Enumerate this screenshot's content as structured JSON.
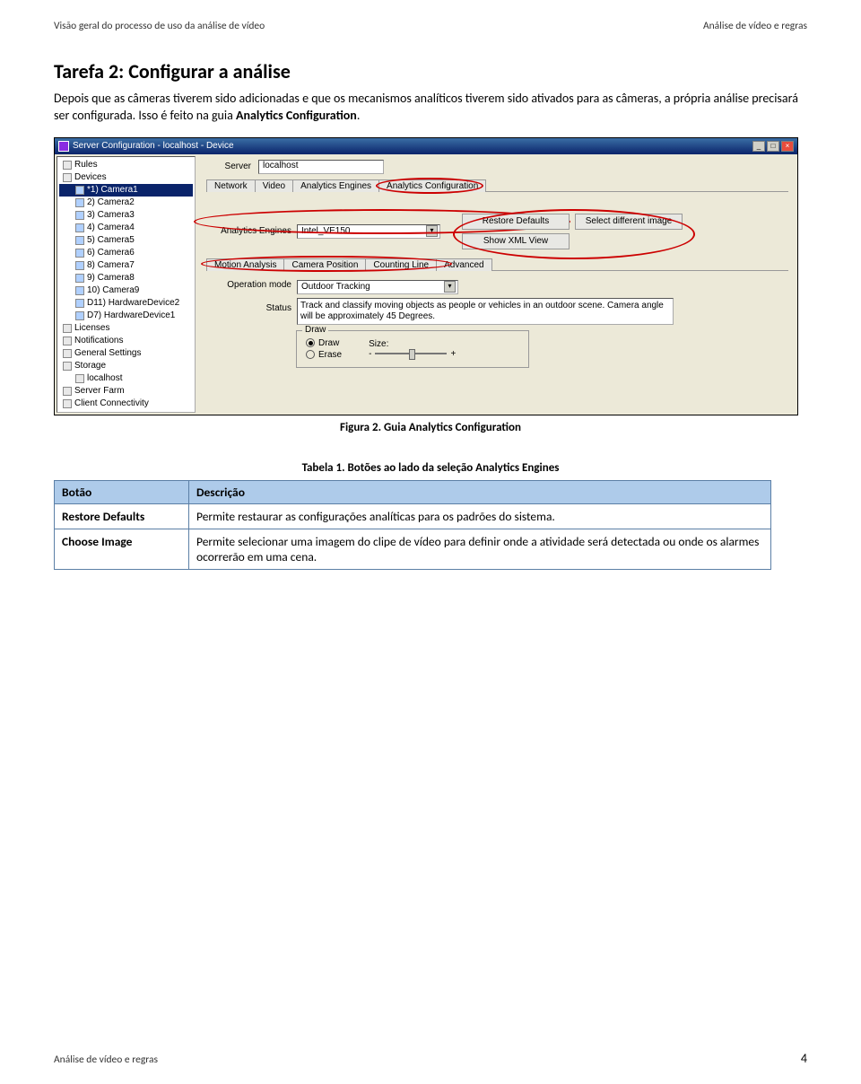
{
  "header": {
    "left": "Visão geral do processo de uso da análise de vídeo",
    "right": "Análise de vídeo e regras"
  },
  "task": {
    "title": "Tarefa 2:  Configurar a análise",
    "p1": "Depois que as câmeras tiverem sido adicionadas e que os mecanismos analíticos tiverem sido ativados para as câmeras, a própria análise precisará ser configurada. Isso é feito na guia ",
    "p1bold": "Analytics Configuration",
    "p1end": "."
  },
  "win": {
    "title": "Server Configuration - localhost - Device",
    "tree": {
      "rules": "Rules",
      "devices": "Devices",
      "items": [
        "*1) Camera1",
        "2) Camera2",
        "3) Camera3",
        "4) Camera4",
        "5) Camera5",
        "6) Camera6",
        "8) Camera7",
        "9) Camera8",
        "10) Camera9",
        "D11) HardwareDevice2",
        "D7) HardwareDevice1"
      ],
      "licenses": "Licenses",
      "notifications": "Notifications",
      "general": "General Settings",
      "storage": "Storage",
      "localhost": "localhost",
      "farm": "Server Farm",
      "client": "Client Connectivity"
    },
    "server_label": "Server",
    "server_value": "localhost",
    "tabs": [
      "Network",
      "Video",
      "Analytics Engines",
      "Analytics Configuration"
    ],
    "engine_label": "Analytics Engines",
    "engine_value": "Intel_VE150",
    "btn_restore": "Restore Defaults",
    "btn_select": "Select different image",
    "btn_xml": "Show XML View",
    "subtabs": [
      "Motion Analysis",
      "Camera Position",
      "Counting Line",
      "Advanced"
    ],
    "opmode_label": "Operation mode",
    "opmode_value": "Outdoor Tracking",
    "status_label": "Status",
    "status_text": "Track and classify moving objects as people or vehicles in an outdoor scene. Camera angle will be approximately 45 Degrees.",
    "draw": {
      "legend": "Draw",
      "opt_draw": "Draw",
      "opt_erase": "Erase",
      "size": "Size:",
      "minus": "-",
      "plus": "+"
    }
  },
  "figure_caption": "Figura 2. Guia Analytics Configuration",
  "table_caption": "Tabela 1. Botões ao lado da seleção Analytics Engines",
  "table": {
    "h1": "Botão",
    "h2": "Descrição",
    "r1c1": "Restore Defaults",
    "r1c2": "Permite restaurar as configurações analíticas para os padrões do sistema.",
    "r2c1": "Choose Image",
    "r2c2": "Permite selecionar uma imagem do clipe de vídeo para definir onde a atividade será detectada ou onde os alarmes ocorrerão em uma cena."
  },
  "footer": {
    "left": "Análise de vídeo e regras",
    "page": "4"
  }
}
